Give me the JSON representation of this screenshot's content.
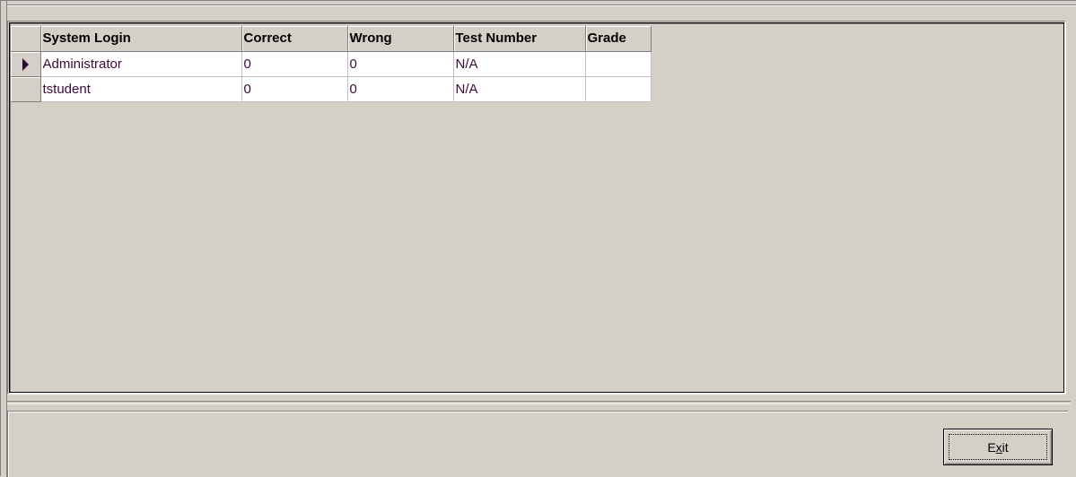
{
  "grid": {
    "columns": [
      "System Login",
      "Correct",
      "Wrong",
      "Test Number",
      "Grade"
    ],
    "rows": [
      {
        "selected": true,
        "cells": [
          "Administrator",
          "0",
          "0",
          "N/A",
          ""
        ]
      },
      {
        "selected": false,
        "cells": [
          "tstudent",
          "0",
          "0",
          "N/A",
          ""
        ]
      }
    ]
  },
  "footer": {
    "exit_label_pre": "E",
    "exit_label_mnemonic": "x",
    "exit_label_post": "it"
  },
  "colors": {
    "background": "#d4d0c8",
    "cell_text": "#3a0a3a",
    "cell_background": "#ffffff"
  },
  "icons": {
    "current_row": "right-triangle-pointer"
  }
}
